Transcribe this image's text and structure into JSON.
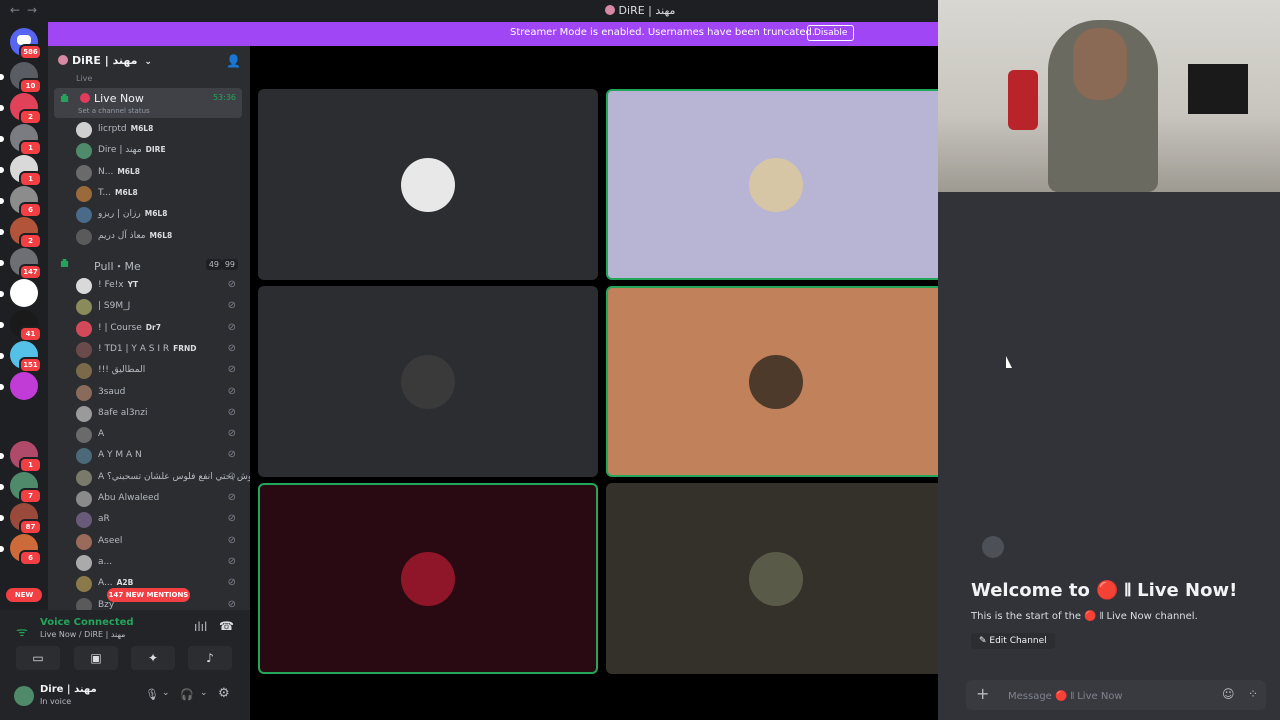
{
  "window": {
    "title": "DiRE | مهند",
    "back": "←",
    "forward": "→"
  },
  "rail": {
    "dm_badge": "586",
    "servers": [
      {
        "badge": "10",
        "color": "#5a5c63"
      },
      {
        "badge": "2",
        "color": "#e0425a"
      },
      {
        "badge": "1",
        "color": "#7a7c82"
      },
      {
        "badge": "1",
        "color": "#d9d9d9"
      },
      {
        "badge": "6",
        "color": "#8c8c8c"
      },
      {
        "badge": "2",
        "color": "#b2543a"
      },
      {
        "badge": "147",
        "color": "#6d6f75"
      },
      {
        "badge": "",
        "color": "#ffffff"
      },
      {
        "badge": "41",
        "color": "#1a1a1a"
      },
      {
        "badge": "151",
        "color": "#55c0e8"
      },
      {
        "badge": "",
        "color": "#c13bd6"
      },
      {
        "badge": "1",
        "color": "#b04a6a"
      },
      {
        "badge": "7",
        "color": "#4f8a6b"
      },
      {
        "badge": "87",
        "color": "#9a4a3a"
      },
      {
        "badge": "6",
        "color": "#cc6a3a"
      }
    ],
    "new_label": "NEW"
  },
  "banner": {
    "message": "Streamer Mode is enabled. Usernames have been truncated.",
    "disable": "Disable",
    "color": "#a046f5"
  },
  "sidebar": {
    "server_name": "DiRE | مهند",
    "category": "Live",
    "live_channel": {
      "name": "Live Now",
      "timer": "53:36",
      "status_prompt": "Set a channel status"
    },
    "live_members": [
      {
        "name": "licrptd",
        "tag": "M6L8"
      },
      {
        "name": "Dire | مهند",
        "tag": "DIRE"
      },
      {
        "name": "N...",
        "tag": "M6L8"
      },
      {
        "name": "T...",
        "tag": "M6L8"
      },
      {
        "name": "رزان | ريزو",
        "tag": "M6L8"
      },
      {
        "name": "معاذ آل دريم",
        "tag": "M6L8"
      }
    ],
    "pull_channel": {
      "name": "Pull・Me",
      "count_a": "49",
      "count_b": "99"
    },
    "pull_members": [
      {
        "name": "! Fe!x",
        "tag": "YT"
      },
      {
        "name": "| S9M_J",
        "tag": ""
      },
      {
        "name": "! | Course",
        "tag": "Dr7"
      },
      {
        "name": "! TD1 | Y A S I R",
        "tag": "FRND"
      },
      {
        "name": "!!! المطاليق",
        "tag": ""
      },
      {
        "name": "3saud",
        "tag": ""
      },
      {
        "name": "8afe al3nzi",
        "tag": ""
      },
      {
        "name": "A",
        "tag": ""
      },
      {
        "name": "A Y M A N",
        "tag": ""
      },
      {
        "name": "A وش يحتي انفع فلوس علشان تسحبني؟",
        "tag": ""
      },
      {
        "name": "Abu Alwaleed",
        "tag": ""
      },
      {
        "name": "aR",
        "tag": ""
      },
      {
        "name": "Aseel",
        "tag": ""
      },
      {
        "name": "a...",
        "tag": ""
      },
      {
        "name": "A...",
        "tag": "A2B"
      },
      {
        "name": "Bzy",
        "tag": ""
      }
    ],
    "mentions": "147 NEW MENTIONS"
  },
  "voice": {
    "status": "Voice Connected",
    "location": "Live Now / DiRE | مهند",
    "user_name": "Dire | مهند",
    "user_status": "In voice"
  },
  "stage": {
    "tiles": [
      {
        "bg": "#2b2d31",
        "speaking": false,
        "avatar": "#e8e8e8"
      },
      {
        "bg": "#b8b4d3",
        "speaking": true,
        "avatar": "#d6c6a6"
      },
      {
        "bg": "#2b2d31",
        "speaking": false,
        "avatar": "#3a3a3a"
      },
      {
        "bg": "#c1815a",
        "speaking": true,
        "avatar": "#4e3a2a"
      },
      {
        "bg": "#2a0a12",
        "speaking": true,
        "avatar": "#8f1628"
      },
      {
        "bg": "#34312b",
        "speaking": false,
        "avatar": "#5a5a48"
      }
    ]
  },
  "chat": {
    "welcome": "Welcome to 🔴 𝍪 Live Now!",
    "start_text": "This is the start of the 🔴 𝍪 Live Now channel.",
    "edit_channel": "Edit Channel",
    "placeholder": "Message 🔴 𝍪 Live Now"
  }
}
